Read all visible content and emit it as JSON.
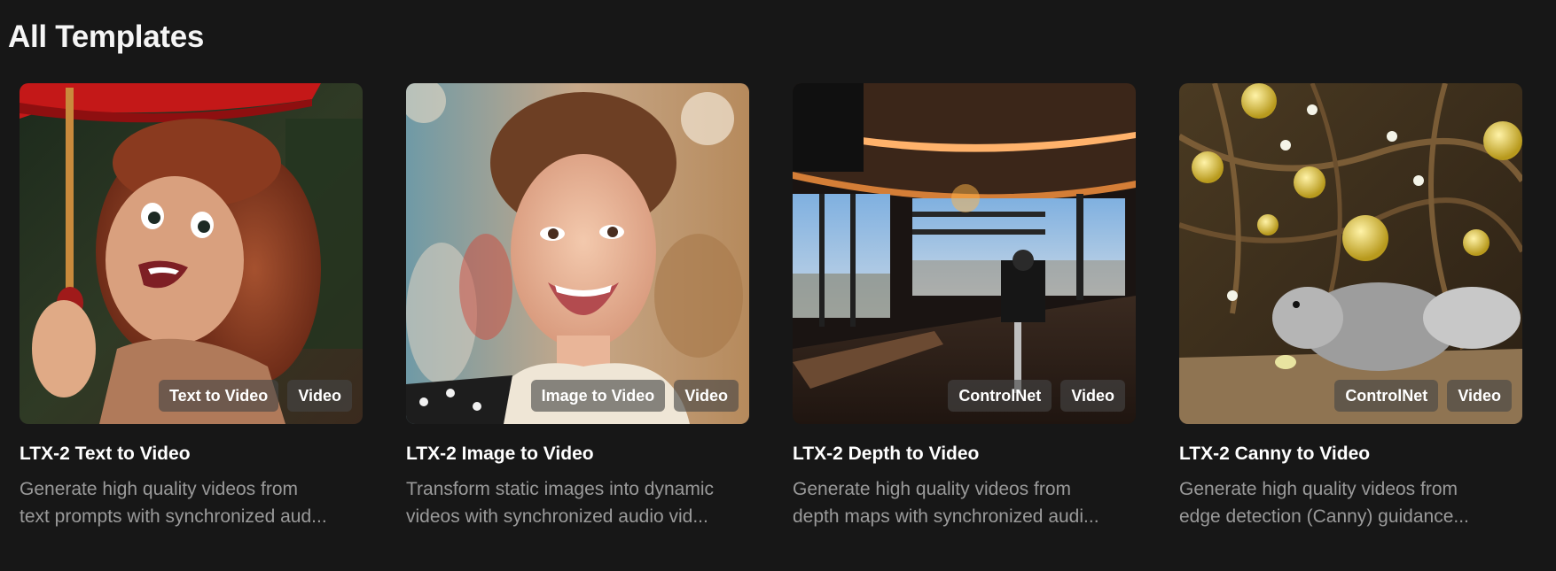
{
  "page": {
    "title": "All Templates"
  },
  "templates": [
    {
      "title": "LTX-2 Text to Video",
      "desc_line1": "Generate high quality videos from",
      "desc_line2": "text prompts with synchronized aud...",
      "tags": [
        "Text to Video",
        "Video"
      ],
      "thumbnail": "claymation-girl-with-red-umbrella"
    },
    {
      "title": "LTX-2 Image to Video",
      "desc_line1": "Transform static images into dynamic",
      "desc_line2": "videos with synchronized audio vid...",
      "tags": [
        "Image to Video",
        "Video"
      ],
      "thumbnail": "smiling-woman-portrait"
    },
    {
      "title": "LTX-2 Depth to Video",
      "desc_line1": "Generate high quality videos from",
      "desc_line2": "depth maps with synchronized audi...",
      "tags": [
        "ControlNet",
        "Video"
      ],
      "thumbnail": "loft-interior-city-view"
    },
    {
      "title": "LTX-2 Canny to Video",
      "desc_line1": "Generate high quality videos from",
      "desc_line2": "edge detection (Canny) guidance...",
      "tags": [
        "ControlNet",
        "Video"
      ],
      "thumbnail": "squirrel-with-gold-ornaments"
    }
  ],
  "colors": {
    "background": "#171717",
    "title_text": "#ffffff",
    "description_text": "#9a9a9a",
    "tag_background": "#464646"
  }
}
